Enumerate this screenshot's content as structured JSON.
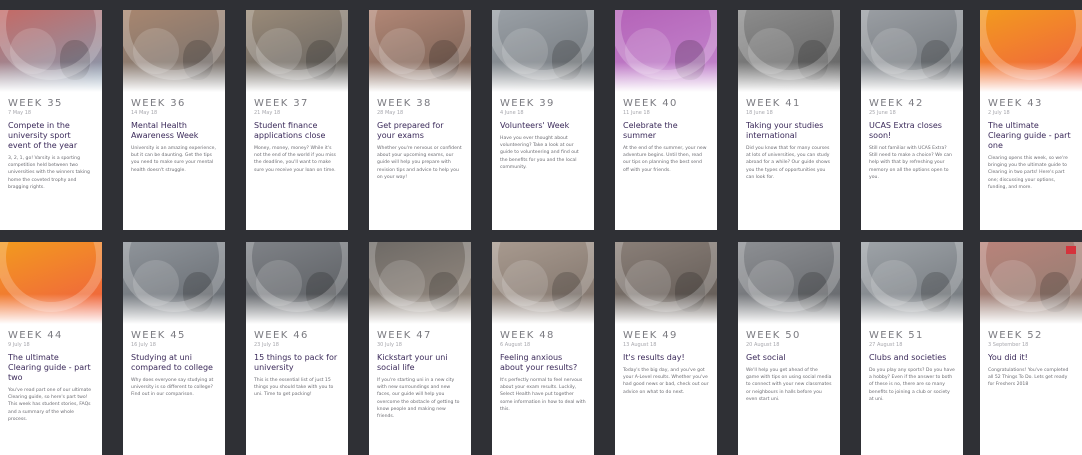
{
  "cards": [
    {
      "week": "WEEK 35",
      "date": "7 May 18",
      "title": "Compete in the university sport event of the year",
      "desc": "3, 2, 1, go! Varsity is a sporting competition held between two universities with the winners taking home the coveted trophy and bragging rights.",
      "image_colors": [
        "#c46a66",
        "#7f9fb7"
      ]
    },
    {
      "week": "WEEK 36",
      "date": "14 May 18",
      "title": "Mental Health Awareness Week",
      "desc": "University is an amazing experience, but it can be daunting. Get the tips you need to make sure your mental health doesn't struggle.",
      "image_colors": [
        "#a8866f",
        "#6f6f6f"
      ]
    },
    {
      "week": "WEEK 37",
      "date": "21 May 18",
      "title": "Student finance applications close",
      "desc": "Money, money, money? While it's not the end of the world if you miss the deadline, you'll want to make sure you receive your loan on time.",
      "image_colors": [
        "#9a8a78",
        "#5e5e5e"
      ]
    },
    {
      "week": "WEEK 38",
      "date": "28 May 18",
      "title": "Get prepared for your exams",
      "desc": "Whether you're nervous or confident about your upcoming exams, our guide will help you prepare with revision tips and advice to help you on your way!",
      "image_colors": [
        "#b28776",
        "#6f5b50"
      ]
    },
    {
      "week": "WEEK 39",
      "date": "4 June 18",
      "title": "Volunteers' Week",
      "desc": "Have you ever thought about volunteering? Take a look at our guide to volunteering and find out the benefits for you and the local community.",
      "image_colors": [
        "#9aa0a6",
        "#6e7378"
      ]
    },
    {
      "week": "WEEK 40",
      "date": "11 June 18",
      "title": "Celebrate the summer",
      "desc": "At the end of the summer, your new adventure begins. Until then, read our tips on planning the best send off with your friends.",
      "image_colors": [
        "#b563b8",
        "#c48ad0"
      ]
    },
    {
      "week": "WEEK 41",
      "date": "18 June 18",
      "title": "Taking your studies international",
      "desc": "Did you know that for many courses at lots of universities, you can study abroad for a while? Our guide shows you the types of opportunities you can look for.",
      "image_colors": [
        "#8c8c8c",
        "#5f5f5f"
      ]
    },
    {
      "week": "WEEK 42",
      "date": "25 June 18",
      "title": "UCAS Extra closes soon!",
      "desc": "Still not familiar with UCAS Extra? Still need to make a choice? We can help with that by refreshing your memory on all the options open to you.",
      "image_colors": [
        "#9a9ea3",
        "#6b7075"
      ]
    },
    {
      "week": "WEEK 43",
      "date": "2 July 18",
      "title": "The ultimate Clearing guide - part one",
      "desc": "Clearing opens this week, so we're bringing you the ultimate guide to Clearing in two parts! Here's part one; discussing your options, funding, and more.",
      "image_colors": [
        "#f39a1e",
        "#ef5a44"
      ]
    },
    {
      "week": "WEEK 44",
      "date": "9 July 18",
      "title": "The ultimate Clearing guide - part two",
      "desc": "You've read part one of our ultimate Clearing guide, so here's part two! This week has student stories, FAQs and a summary of the whole process.",
      "image_colors": [
        "#f39a1e",
        "#ef5a44"
      ]
    },
    {
      "week": "WEEK 45",
      "date": "16 July 18",
      "title": "Studying at uni compared to college",
      "desc": "Why does everyone say studying at university is so different to college? Find out in our comparison.",
      "image_colors": [
        "#8f949a",
        "#60656b"
      ]
    },
    {
      "week": "WEEK 46",
      "date": "23 July 18",
      "title": "15 things to pack for university",
      "desc": "This is the essential list of just 15 things you should take with you to uni. Time to get packing!",
      "image_colors": [
        "#7f8287",
        "#55585c"
      ]
    },
    {
      "week": "WEEK 47",
      "date": "30 July 18",
      "title": "Kickstart your uni social life",
      "desc": "If you're starting uni in a new city with new surroundings and new faces, our guide will help you overcome the obstacle of getting to know people and making new friends.",
      "image_colors": [
        "#6e6a66",
        "#9b8f84"
      ]
    },
    {
      "week": "WEEK 48",
      "date": "6 August 18",
      "title": "Feeling anxious about your results?",
      "desc": "It's perfectly normal to feel nervous about your exam results. Luckily, Select Health have put together some information in how to deal with this.",
      "image_colors": [
        "#a89a8f",
        "#7a6e66"
      ]
    },
    {
      "week": "WEEK 49",
      "date": "13 August 18",
      "title": "It's results day!",
      "desc": "Today's the big day, and you've got your A-Level results. Whether you've had good news or bad, check out our advice on what to do next.",
      "image_colors": [
        "#8a7f78",
        "#5c5550"
      ]
    },
    {
      "week": "WEEK 50",
      "date": "20 August 18",
      "title": "Get social",
      "desc": "We'll help you get ahead of the game with tips on using social media to connect with your new classmates or neighbours in halls before you even start uni.",
      "image_colors": [
        "#8d8f93",
        "#5f6266"
      ]
    },
    {
      "week": "WEEK 51",
      "date": "27 August 18",
      "title": "Clubs and societies",
      "desc": "Do you play any sports? Do you have a hobby? Even if the answer to both of these is no, there are so many benefits to joining a club or society at uni.",
      "image_colors": [
        "#9ea3a8",
        "#6d7277"
      ]
    },
    {
      "week": "WEEK 52",
      "date": "3 September 18",
      "title": "You did it!",
      "desc": "Congratulations! You've completed all 52 Things To Do. Lets get ready for Freshers 2018",
      "image_colors": [
        "#b9837a",
        "#8a7c72"
      ]
    }
  ]
}
